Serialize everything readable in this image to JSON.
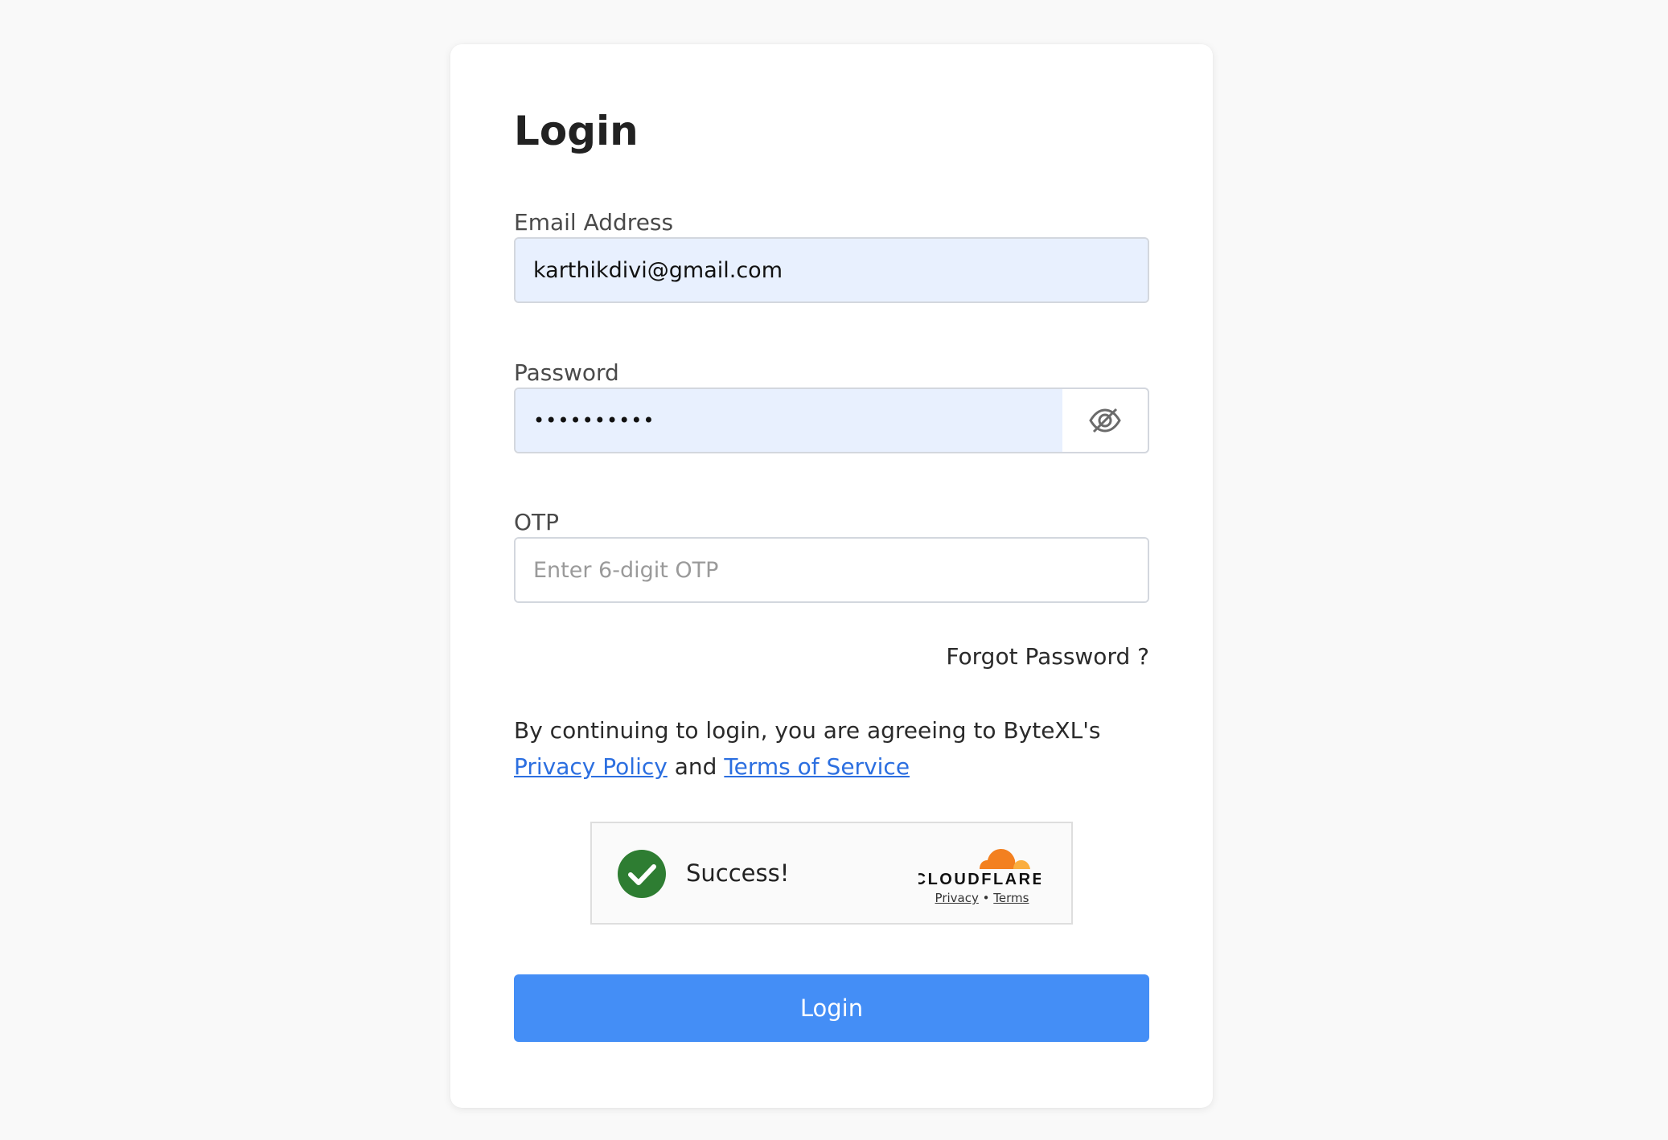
{
  "title": "Login",
  "email": {
    "label": "Email Address",
    "value": "karthikdivi@gmail.com"
  },
  "password": {
    "label": "Password",
    "value": "••••••••••",
    "toggle_icon": "eye-off-icon"
  },
  "otp": {
    "label": "OTP",
    "value": "",
    "placeholder": "Enter 6-digit OTP"
  },
  "forgot_password": "Forgot Password ?",
  "terms": {
    "prefix": "By continuing to login, you are agreeing to ByteXL's ",
    "privacy_link": "Privacy Policy",
    "conjunction": " and ",
    "tos_link": "Terms of Service"
  },
  "captcha": {
    "status": "Success!",
    "provider": "CLOUDFLARE",
    "privacy_link": "Privacy",
    "separator": "•",
    "terms_link": "Terms",
    "status_icon": "check-circle-icon",
    "status_color": "#2e7d32"
  },
  "login_button": "Login",
  "colors": {
    "accent": "#448ef6",
    "link": "#2c6fe0",
    "autofill": "#e8f0fe",
    "cloudflare_orange": "#f38020"
  }
}
